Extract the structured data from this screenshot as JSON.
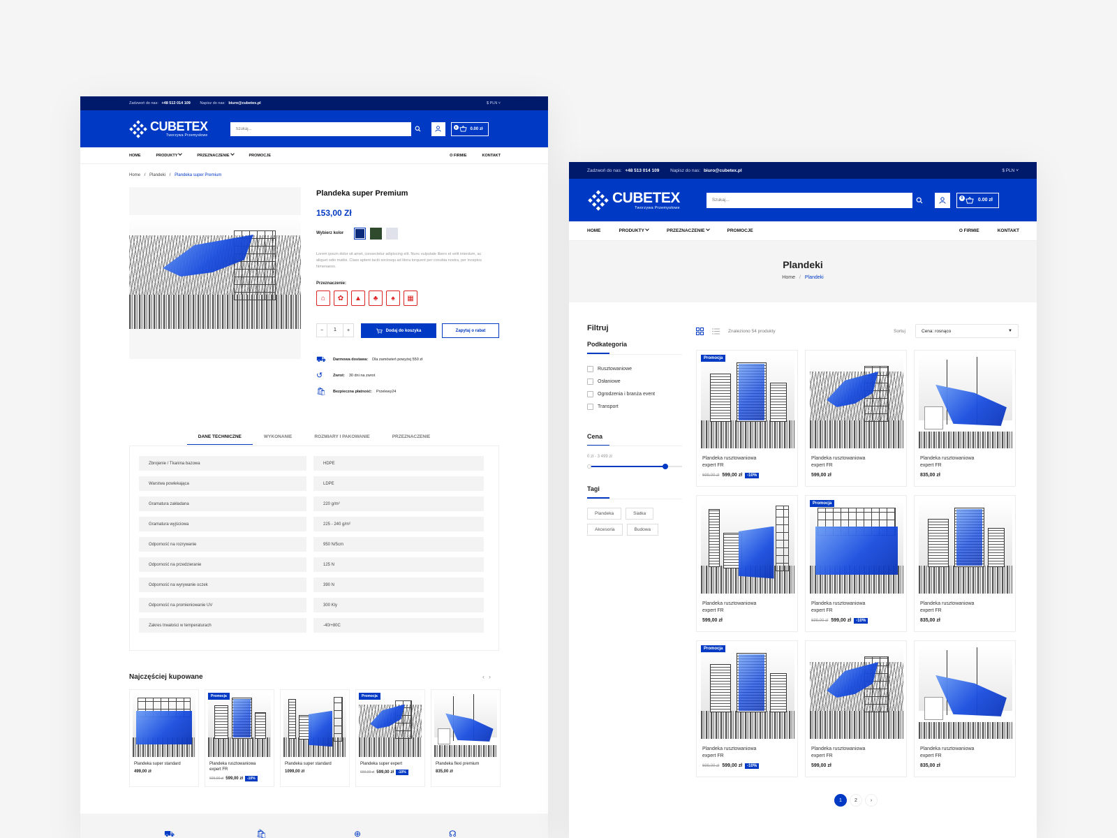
{
  "site": {
    "logo_text": "CUBETEX",
    "logo_sub": "Tworzywa Przemysłowe",
    "call_label": "Zadzwoń do nas:",
    "phone": "+48 513 014 109",
    "write_label": "Napisz do nas:",
    "email": "biuro@cubetex.pl",
    "currency": "$ PLN",
    "search_placeholder": "Szukaj...",
    "cart_count": "0",
    "cart_total": "0.00 zł",
    "nav_left": [
      "HOME",
      "PRODUKTY",
      "PRZEZNACZENIE",
      "PROMOCJE"
    ],
    "nav_right": [
      "O FIRMIE",
      "KONTAKT"
    ],
    "colors": {
      "primary": "#0039c4",
      "topbar": "#001a6b"
    }
  },
  "product_page": {
    "breadcrumb": [
      "Home",
      "/",
      "Plandeki",
      "/",
      "Plandeka super Premium"
    ],
    "title": "Plandeka super Premium",
    "price": "153,00 Zł",
    "color_label": "Wybierz kolor",
    "swatches": [
      "#0c2a7a",
      "#2f4a2c",
      "#dfe2ea"
    ],
    "description": "Lorem ipsum dolor sit amet, consectetur adipiscing elit. Nunc vulputate libero et velit interdum, ac aliquet odio mattis. Class aptent taciti sociosqu ad litora torquent per conubia nostra, per inceptos himenaeos.",
    "purpose_label": "Przeznaczenie:",
    "purpose_icons": [
      "house-icon",
      "factory-icon",
      "warehouse-icon",
      "agriculture-icon",
      "garden-icon",
      "storage-icon"
    ],
    "qty_minus": "−",
    "qty": "1",
    "qty_plus": "+",
    "add_to_cart": "Dodaj do koszyka",
    "ask_discount": "Zapytaj o rabat",
    "benefits": [
      {
        "label": "Darmowa dostawa:",
        "text": "Dla zamówień powyżej 550 zł",
        "icon": "truck-icon"
      },
      {
        "label": "Zwrot:",
        "text": "30 dni na zwrot",
        "icon": "return-icon"
      },
      {
        "label": "Bezpieczna płatność:",
        "text": "Przelewy24",
        "icon": "secure-bag-icon"
      }
    ],
    "tabs": [
      "DANE TECHNICZNE",
      "WYKONANIE",
      "ROZMIARY I PAKOWANIE",
      "PRZEZNACZENIE"
    ],
    "specs": [
      {
        "name": "Zbrojenie / Tkanina bazowa",
        "value": "HDPE"
      },
      {
        "name": "Warstwa powlekająca",
        "value": "LDPE"
      },
      {
        "name": "Gramatura zakładana",
        "value": "220 g/m²"
      },
      {
        "name": "Gramatura wyjściowa",
        "value": "225 - 240 g/m²"
      },
      {
        "name": "Odporność na rozrywanie",
        "value": "950 N/5cm"
      },
      {
        "name": "Odporność na przedzieranie",
        "value": "125 N"
      },
      {
        "name": "Odporność na wyrywanie oczek",
        "value": "390 N"
      },
      {
        "name": "Odporność na promieniowanie UV",
        "value": "300 Kly"
      },
      {
        "name": "Zakres trwałości w temperaturach",
        "value": "-40/+80C"
      }
    ],
    "bestsellers_title": "Najczęściej kupowane",
    "bestsellers": [
      {
        "name": "Plandeka super standard",
        "price": "499,00 zł",
        "old": "",
        "disc": "",
        "badge": ""
      },
      {
        "name": "Plandeka rusztowaniowa expert FR",
        "price": "599,00 zł",
        "old": "699,00 zł",
        "disc": "-10%",
        "badge": "Promocja"
      },
      {
        "name": "Plandeka super standard",
        "price": "1099,00 zł",
        "old": "",
        "disc": "",
        "badge": ""
      },
      {
        "name": "Plandeka super expert",
        "price": "599,00 zł",
        "old": "699,00 zł",
        "disc": "-10%",
        "badge": "Promocja"
      },
      {
        "name": "Plandeka flexi premium",
        "price": "835,00 zł",
        "old": "",
        "disc": "",
        "badge": ""
      }
    ]
  },
  "listing_page": {
    "title": "Plandeki",
    "breadcrumb": [
      "Home",
      "/",
      "Plandeki"
    ],
    "filter_title": "Filtruj",
    "subcat_title": "Podkategoria",
    "subcats": [
      "Rusztowaniowe",
      "Osłaniowe",
      "Ogrodzenia i branża event",
      "Transport"
    ],
    "price_title": "Cena",
    "price_range": "0 zł - 3 499 zł",
    "price_fill": 0.82,
    "tags_title": "Tagi",
    "tags": [
      "Plandeka",
      "Siatka",
      "Akcesoria",
      "Budowa"
    ],
    "found": "Znaleziono 54 produkty",
    "sort_label": "Sortuj",
    "sort_value": "Cena: rosnąco",
    "products": [
      {
        "name": "Plandeka rusztowaniowa expert FR",
        "price": "599,00 zł",
        "old": "699,00 zł",
        "disc": "-10%",
        "badge": "Promocja"
      },
      {
        "name": "Plandeka rusztowaniowa expert FR",
        "price": "599,00 zł",
        "old": "",
        "disc": "",
        "badge": ""
      },
      {
        "name": "Plandeka rusztowaniowa expert FR",
        "price": "835,00 zł",
        "old": "",
        "disc": "",
        "badge": ""
      },
      {
        "name": "Plandeka rusztowaniowa expert FR",
        "price": "599,00 zł",
        "old": "",
        "disc": "",
        "badge": ""
      },
      {
        "name": "Plandeka rusztowaniowa expert FR",
        "price": "599,00 zł",
        "old": "699,00 zł",
        "disc": "-10%",
        "badge": "Promocja"
      },
      {
        "name": "Plandeka rusztowaniowa expert FR",
        "price": "835,00 zł",
        "old": "",
        "disc": "",
        "badge": ""
      },
      {
        "name": "Plandeka rusztowaniowa expert FR",
        "price": "599,00 zł",
        "old": "699,00 zł",
        "disc": "-10%",
        "badge": "Promocja"
      },
      {
        "name": "Plandeka rusztowaniowa expert FR",
        "price": "599,00 zł",
        "old": "",
        "disc": "",
        "badge": ""
      },
      {
        "name": "Plandeka rusztowaniowa expert FR",
        "price": "835,00 zł",
        "old": "",
        "disc": "",
        "badge": ""
      }
    ],
    "pages": [
      "1",
      "2",
      "›"
    ]
  }
}
